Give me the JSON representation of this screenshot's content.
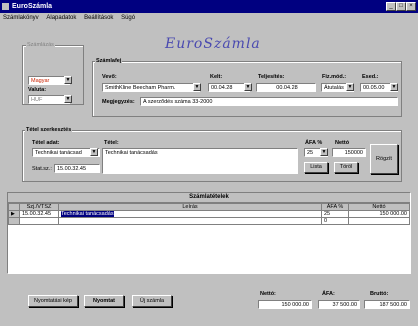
{
  "window": {
    "title": "EuroSzámla"
  },
  "menu": [
    "Számlakönyv",
    "Alapadatok",
    "Beállítások",
    "Súgó"
  ],
  "logo_text": "EuroSzámla",
  "lang_group": {
    "label": "Számlázás",
    "language_value": "Magyar",
    "currency_label": "Valuta:",
    "currency_value": "HUF"
  },
  "invoice": {
    "group_label": "Számlafej",
    "buyer_label": "Vevő:",
    "buyer_value": "SmithKline Beecham Pharm.",
    "issue_label": "Kelt:",
    "issue_value": "00.04.28",
    "delivery_label": "Teljesítés:",
    "delivery_value": "00.04.28",
    "payment_label": "Fiz.mód.:",
    "payment_value": "Átutalás",
    "due_label": "Esed.:",
    "due_value": "00.05.00",
    "note_label": "Megjegyzés:",
    "note_value": "A szerződés száma 33-2000"
  },
  "item": {
    "group_label": "Tétel szerkesztés",
    "type_label": "Tétel adat:",
    "type_value": "Technikai tanácsad",
    "name_label": "Tétel:",
    "name_value": "Technikai tanácsadás",
    "vat_label": "ÁFA %",
    "vat_value": "25",
    "net_label": "Nettó",
    "net_value": "150000",
    "date_label": "Stat.sz.:",
    "date_value": "15.00.32.45",
    "btn_list": "Lista",
    "btn_delete": "Töröl",
    "btn_record": "Rögzít"
  },
  "table": {
    "title": "Számlatételek",
    "headers": [
      "Szj./VTSZ",
      "Leírás",
      "ÁFA %",
      "Nettó"
    ],
    "rows": [
      {
        "code": "15.00.32.45",
        "desc": "Technikai tanácsadás",
        "vat": "25",
        "net": "150 000.00"
      },
      {
        "code": "",
        "desc": "",
        "vat": "0",
        "net": ""
      }
    ]
  },
  "buttons": {
    "history": "Nyomtatási kép",
    "print": "Nyomtat",
    "new": "Új számla"
  },
  "totals": {
    "net_label": "Nettó:",
    "net_value": "150 000.00",
    "vat_label": "ÁFA:",
    "vat_value": "37 500.00",
    "gross_label": "Bruttó:",
    "gross_value": "187 500.00"
  },
  "colors": {
    "title_bar": "#000080",
    "window": "#c0c0c0",
    "selection": "#000080",
    "logo": "#4a4ab0",
    "lang_text": "#cc2200"
  }
}
